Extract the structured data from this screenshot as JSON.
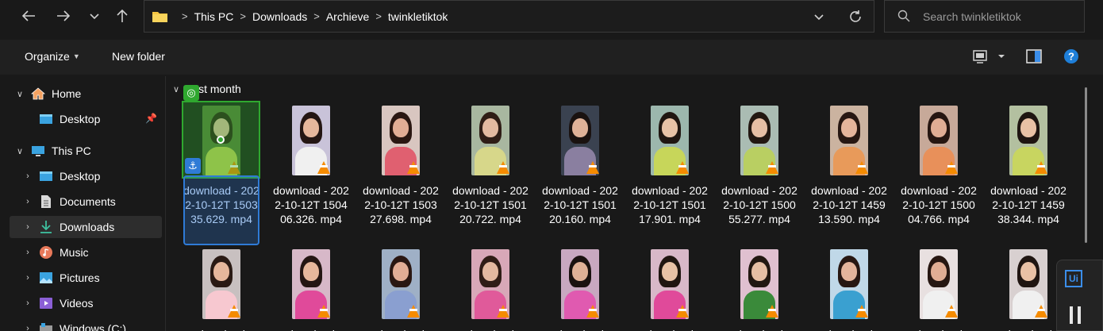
{
  "address": {
    "crumbs": [
      "This PC",
      "Downloads",
      "Archieve",
      "twinkletiktok"
    ]
  },
  "search": {
    "placeholder": "Search twinkletiktok"
  },
  "command_bar": {
    "organize": "Organize",
    "new_folder": "New folder"
  },
  "sidebar": {
    "items": [
      {
        "label": "Home",
        "icon": "home-icon"
      },
      {
        "label": "Desktop",
        "icon": "desktop-icon"
      },
      {
        "label": "This PC",
        "icon": "pc-icon"
      },
      {
        "label": "Desktop",
        "icon": "desktop-icon"
      },
      {
        "label": "Documents",
        "icon": "documents-icon"
      },
      {
        "label": "Downloads",
        "icon": "downloads-icon"
      },
      {
        "label": "Music",
        "icon": "music-icon"
      },
      {
        "label": "Pictures",
        "icon": "pictures-icon"
      },
      {
        "label": "Videos",
        "icon": "videos-icon"
      },
      {
        "label": "Windows (C:)",
        "icon": "drive-icon"
      }
    ]
  },
  "content": {
    "group_label": "st month",
    "files_row1": [
      "download - 2022-10-12T 150335.629. mp4",
      "download - 2022-10-12T 150406.326. mp4",
      "download - 2022-10-12T 150327.698. mp4",
      "download - 2022-10-12T 150120.722. mp4",
      "download - 2022-10-12T 150120.160. mp4",
      "download - 2022-10-12T 150117.901. mp4",
      "download - 2022-10-12T 150055.277. mp4",
      "download - 2022-10-12T 145913.590. mp4",
      "download - 2022-10-12T 150004.766. mp4",
      "download - 2022-10-12T 145938.344. mp4"
    ],
    "files_row2": [
      "download",
      "download",
      "download",
      "download",
      "download",
      "download",
      "download",
      "download",
      "download",
      "download"
    ]
  },
  "widget": {
    "label": "Ui"
  }
}
